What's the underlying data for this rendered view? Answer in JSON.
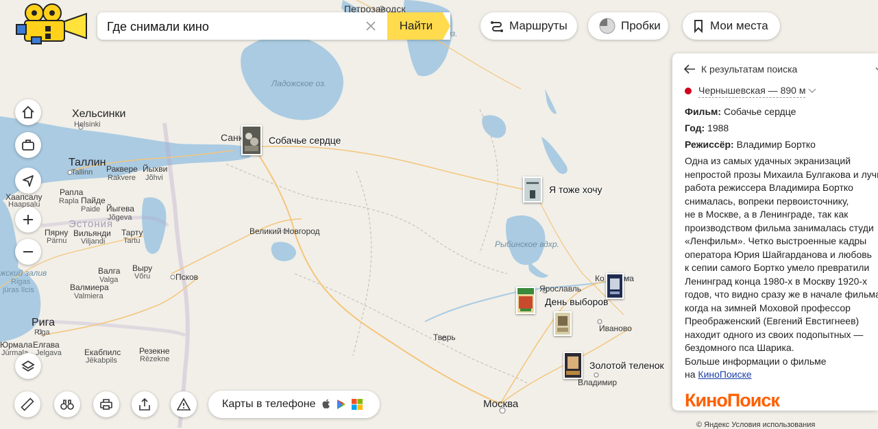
{
  "search": {
    "value": "Где снимали кино",
    "button": "Найти"
  },
  "toolbar": {
    "routes": "Маршруты",
    "traffic": "Пробки",
    "my_places": "Мои места"
  },
  "map_labels": {
    "petrozavodsk": "Петрозаводск",
    "helsinki": "Хельсинки",
    "helsinki_sub": "Helsinki",
    "tallinn": "Таллин",
    "tallinn_sub": "Tallinn",
    "rakvere": "Раквере",
    "rakvere_sub": "Rakvere",
    "johvi": "Йыхви",
    "johvi_sub": "Jõhvi",
    "rapla": "Рапла",
    "rapla_sub": "Rapla",
    "paide": "Пайде",
    "paide_sub": "Paide",
    "haapsalu": "Хаапсалу",
    "haapsalu_sub": "Haapsalu",
    "jogeva": "Йыгева",
    "jogeva_sub": "Jõgeva",
    "estonia": "Эстония",
    "parnu": "Пярну",
    "parnu_sub": "Pärnu",
    "viljandi": "Вильянди",
    "viljandi_sub": "Viljandi",
    "tartu": "Тарту",
    "tartu_sub": "Tartu",
    "valga": "Валга",
    "valga_sub": "Valga",
    "voru": "Выру",
    "voru_sub": "Võru",
    "gulf": "жский залив",
    "gulf_sub1": "Rigas",
    "gulf_sub2": "jūras līcis",
    "valmiera": "Валмиера",
    "valmiera_sub": "Valmiera",
    "pskov": "Псков",
    "riga": "Рига",
    "riga_sub": "Riga",
    "jurmala": "Юрмала",
    "jurmala_sub": "Jūrmala",
    "jelgava": "Елгава",
    "jelgava_sub": "Jelgava",
    "jekabpils": "Екабпилс",
    "jekabpils_sub": "Jēkabpils",
    "rezekne": "Резекне",
    "rezekne_sub": "Rēzekne",
    "ladoga": "Ладожское оз.",
    "oz": "оз.",
    "sankt": "Санк",
    "velikiy_novgorod": "Великий Новгород",
    "rybinsk": "Рыбинское вдхр.",
    "yaroslavl": "Ярославль",
    "kostroma": "Ко",
    "ma": "ма",
    "tver": "Тверь",
    "ivanovo": "Иваново",
    "vladimir": "Владимир",
    "moskva": "Москва"
  },
  "markers": [
    {
      "title": "Собачье сердце"
    },
    {
      "title": "Я тоже хочу"
    },
    {
      "title": "День выборов"
    },
    {
      "title": "Золотой теленок"
    }
  ],
  "phone_promo": "Карты в телефоне",
  "panel": {
    "back": "К результатам поиска",
    "metro": "Чернышевская — 890 м",
    "film_label": "Фильм:",
    "film": "Собачье сердце",
    "year_label": "Год:",
    "year": "1988",
    "director_label": "Режиссёр:",
    "director": "Владимир Бортко",
    "description": "Одна из самых удачных экранизаций\nнепростой прозы Михаила Булгакова и лучш\nработа режиссера Владимира Бортко\nснималась, вопреки первоисточнику,\nне в Москве, а в Ленинграде, так как\nпроизводством фильма занималась студи\n«Ленфильм». Четко выстроенные кадры\nоператора Юрия Шайгарданова и любовь\nк сепии самого Бортко умело превратили\nЛенинград конца 1980-х в Москву 1920-х\nгодов, что видно сразу же в начале фильма\nкогда на зимней Моховой профессор\nПреображенский (Евгений Евстигнеев)\nнаходит одного из своих подопытных —\nбездомного пса Шарика.",
    "more_text": "Больше информации о фильме",
    "more_prefix": "на",
    "more_link": "КиноПоиске",
    "brand": "КиноПоиск"
  },
  "footer": {
    "copyright": "© Яндекс Условия использования"
  },
  "colors": {
    "water": "#aacbe2",
    "land": "#f1efe8",
    "accent": "#ffdb4d",
    "brand": "#ff5f00",
    "metro": "#d0021b"
  },
  "icons": [
    "camera-logo-icon",
    "clear-icon",
    "routes-icon",
    "traffic-icon",
    "bookmark-icon",
    "home-icon",
    "briefcase-icon",
    "locate-icon",
    "zoom-in-icon",
    "zoom-out-icon",
    "layers-icon",
    "ruler-icon",
    "binoculars-icon",
    "print-icon",
    "share-icon",
    "warning-icon",
    "apple-icon",
    "play-icon",
    "windows-icon",
    "back-arrow-icon",
    "chevron-down-icon"
  ]
}
